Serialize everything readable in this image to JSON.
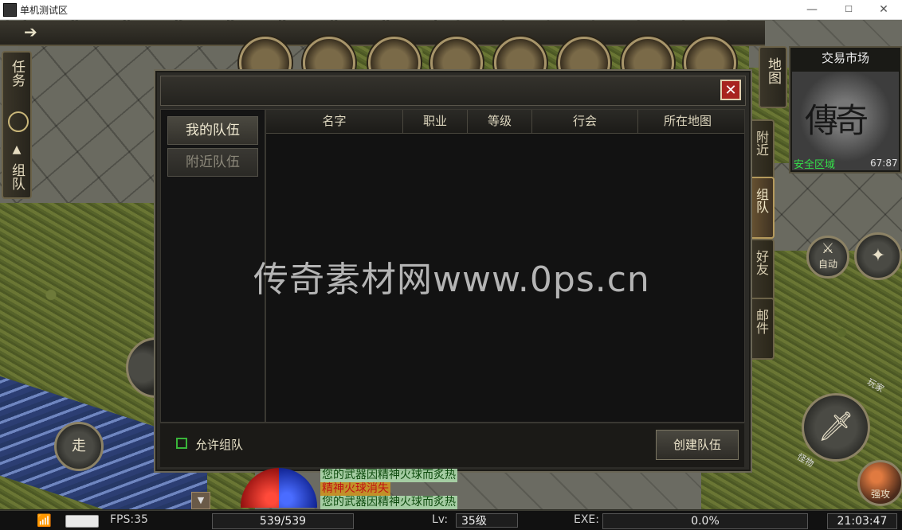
{
  "window": {
    "title": "单机测试区",
    "min": "—",
    "max": "☐",
    "close": "✕"
  },
  "left_nav": {
    "quest": "任务",
    "team": "组队"
  },
  "minimap": {
    "title": "交易市场",
    "map_tab": "地图",
    "zone": "安全区域",
    "coords": "67:87",
    "calligraphy": "傳奇"
  },
  "side_tabs": {
    "nearby": "附近",
    "team": "组队",
    "friends": "好友",
    "mail": "邮件"
  },
  "buttons": {
    "auto": "自动",
    "walk": "走",
    "boost": "强攻",
    "player": "玩家",
    "monster": "怪物"
  },
  "dialog": {
    "close": "✕",
    "tabs": {
      "my_team": "我的队伍",
      "nearby_team": "附近队伍"
    },
    "columns": [
      "名字",
      "职业",
      "等级",
      "行会",
      "所在地图"
    ],
    "allow_team": "允许组队",
    "create_team": "创建队伍"
  },
  "watermark": "传奇素材网www.0ps.cn",
  "chat": [
    {
      "text": "您的武器因精神火球而炙热",
      "kind": "green"
    },
    {
      "text": "精神火球消失",
      "kind": "red"
    },
    {
      "text": "您的武器因精神火球而炙热",
      "kind": "green"
    }
  ],
  "status": {
    "fps": "FPS:35",
    "hp": "539/539",
    "lv_label": "Lv:",
    "lv": "35级",
    "exe_label": "EXE:",
    "exe": "0.0%",
    "exp_fraction": 0.0,
    "time": "21:03:47"
  }
}
